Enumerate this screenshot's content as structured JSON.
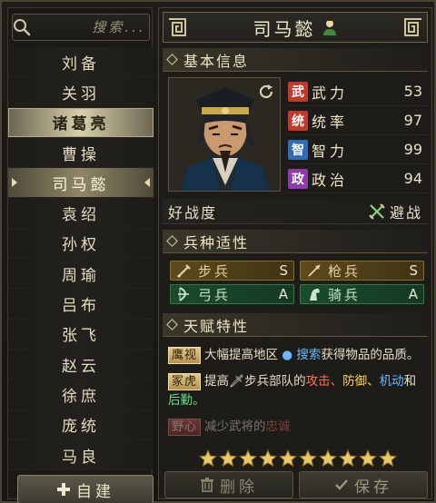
{
  "search": {
    "placeholder": "搜索..."
  },
  "characters": [
    {
      "name": "刘备"
    },
    {
      "name": "关羽"
    },
    {
      "name": "诸葛亮"
    },
    {
      "name": "曹操"
    },
    {
      "name": "司马懿"
    },
    {
      "name": "袁绍"
    },
    {
      "name": "孙权"
    },
    {
      "name": "周瑜"
    },
    {
      "name": "吕布"
    },
    {
      "name": "张飞"
    },
    {
      "name": "赵云"
    },
    {
      "name": "徐庶"
    },
    {
      "name": "庞统"
    },
    {
      "name": "马良"
    }
  ],
  "selected_index": 4,
  "highlighted_index": 2,
  "create_label": "自建",
  "detail": {
    "title": "司马懿",
    "basic_section": "基本信息",
    "stats": [
      {
        "badge": "武",
        "name": "武力",
        "value": "53",
        "color": "#c0392b"
      },
      {
        "badge": "统",
        "name": "统率",
        "value": "97",
        "color": "#c0392b"
      },
      {
        "badge": "智",
        "name": "智力",
        "value": "99",
        "color": "#2e6bb8"
      },
      {
        "badge": "政",
        "name": "政治",
        "value": "94",
        "color": "#8e3aa8"
      }
    ],
    "trait_label": "好战度",
    "trait_value": "避战",
    "troop_section": "兵种适性",
    "troops": [
      {
        "name": "步兵",
        "grade": "S",
        "tier": "s",
        "icon": "sword-icon"
      },
      {
        "name": "枪兵",
        "grade": "S",
        "tier": "s",
        "icon": "spear-icon"
      },
      {
        "name": "弓兵",
        "grade": "A",
        "tier": "a",
        "icon": "bow-icon"
      },
      {
        "name": "骑兵",
        "grade": "A",
        "tier": "a",
        "icon": "horse-icon"
      }
    ],
    "talent_section": "天赋特性",
    "talents": [
      {
        "tag": "鹰视",
        "text_a": "大幅提高地区",
        "text_b": "搜索",
        "text_c": "获得物品的品质。"
      },
      {
        "tag": "冢虎",
        "text_a": "提高",
        "text_b": "步兵部队的",
        "text_c": "攻击、",
        "text_d": "防御、",
        "text_e": "机动",
        "text_f": "和",
        "text_g": "后勤。"
      },
      {
        "tag": "野心",
        "text_a": "减少武将的",
        "text_b": "忠诚",
        "text_c": ""
      }
    ],
    "stars": 10,
    "delete_label": "删除",
    "save_label": "保存"
  }
}
